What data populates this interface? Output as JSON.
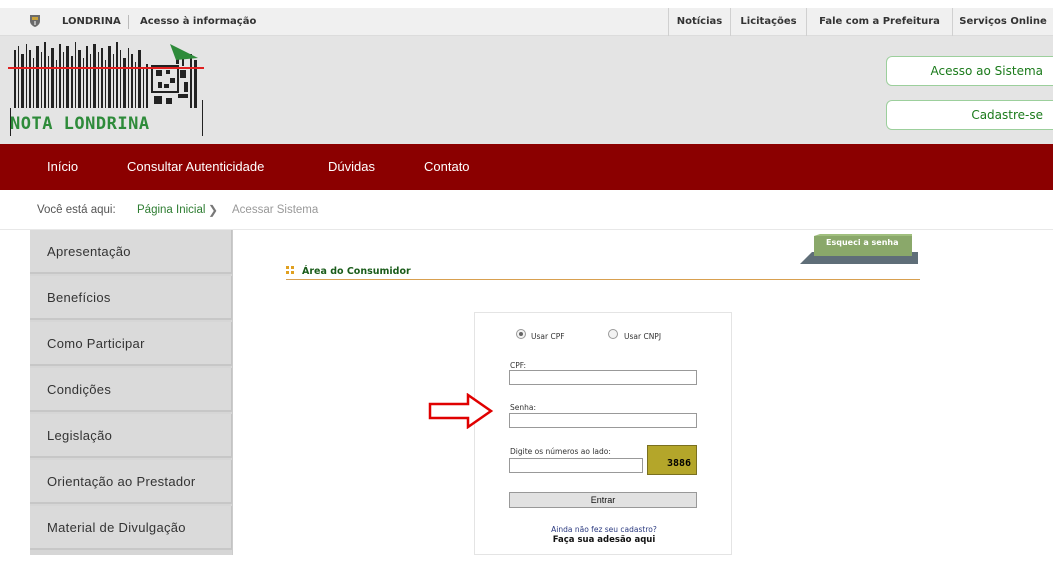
{
  "topbar": {
    "left": [
      "LONDRINA",
      "Acesso à informação"
    ],
    "right": [
      "Notícias",
      "Licitações",
      "Fale com a Prefeitura",
      "Serviços Online"
    ]
  },
  "header": {
    "logo_text": "NOTA LONDRINA",
    "buttons": [
      "Acesso ao Sistema",
      "Cadastre-se"
    ]
  },
  "nav": [
    "Início",
    "Consultar Autenticidade",
    "Dúvidas",
    "Contato"
  ],
  "breadcrumb": {
    "label": "Você está aqui:",
    "home": "Página Inicial",
    "current": "Acessar Sistema"
  },
  "sidebar": [
    "Apresentação",
    "Benefícios",
    "Como Participar",
    "Condições",
    "Legislação",
    "Orientação ao Prestador",
    "Material de Divulgação"
  ],
  "main": {
    "forgot": "Esqueci a senha",
    "title": "Área do Consumidor"
  },
  "login": {
    "radio_cpf": "Usar CPF",
    "radio_cnpj": "Usar CNPJ",
    "cpf_label": "CPF:",
    "senha_label": "Senha:",
    "captcha_label": "Digite os números ao lado:",
    "captcha_value": "3886",
    "submit": "Entrar",
    "no_account": "Ainda não fez seu cadastro?",
    "signup": "Faça sua adesão aqui"
  },
  "colors": {
    "nav_bg": "#8b0000",
    "accent_green": "#2e8b3a",
    "arrow_red": "#e00000"
  }
}
